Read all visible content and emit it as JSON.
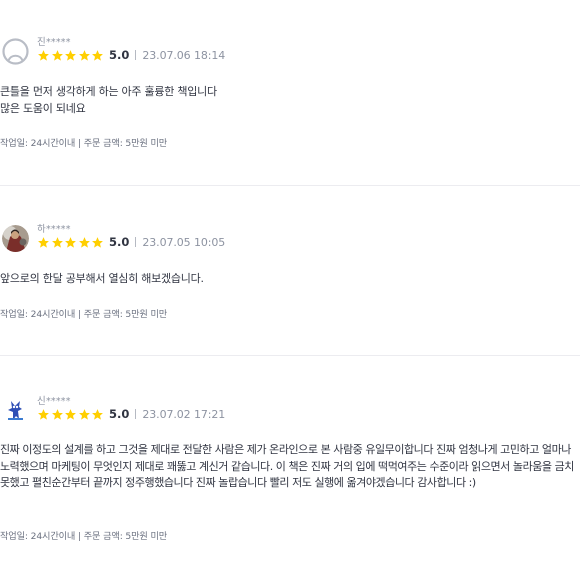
{
  "reviews": [
    {
      "nickname": "진*****",
      "avatar": "default-user-icon",
      "rating_stars": 5,
      "score": "5.0",
      "date": "23.07.06 18:14",
      "content": "큰틀을 먼저 생각하게 하는 아주 훌륭한 책입니다\n많은 도움이 되네요",
      "meta": "작업일: 24시간이내 | 주문 금액: 5만원 미만"
    },
    {
      "nickname": "하*****",
      "avatar": "profile-photo",
      "rating_stars": 5,
      "score": "5.0",
      "date": "23.07.05 10:05",
      "content": "앞으로의 한달 공부해서 열심히 해보겠습니다.",
      "meta": "작업일: 24시간이내 | 주문 금액: 5만원 미만"
    },
    {
      "nickname": "신*****",
      "avatar": "character-avatar",
      "rating_stars": 5,
      "score": "5.0",
      "date": "23.07.02 17:21",
      "content": "진짜 이정도의 설계를 하고 그것을 제대로 전달한 사람은 제가 온라인으로 본 사람중 유일무이합니다 진짜 엄청나게 고민하고 얼마나 노력했으며 마케팅이 무엇인지 제대로 꽤뚫고 계신거 같습니다. 이 책은 진짜 거의 입에 떡먹여주는 수준이라 읽으면서 놀라움을 금치 못했고 펼친순간부터 끝까지 정주행했습니다 진짜 놀랍습니다 빨리 저도 실행에 옮겨야겠습니다 감사합니다 :)",
      "meta": "작업일: 24시간이내 | 주문 금액: 5만원 미만"
    }
  ],
  "colors": {
    "star": "#FFCF00",
    "text": "#303441",
    "muted": "#8D93A1",
    "divider": "#ECECF0"
  }
}
